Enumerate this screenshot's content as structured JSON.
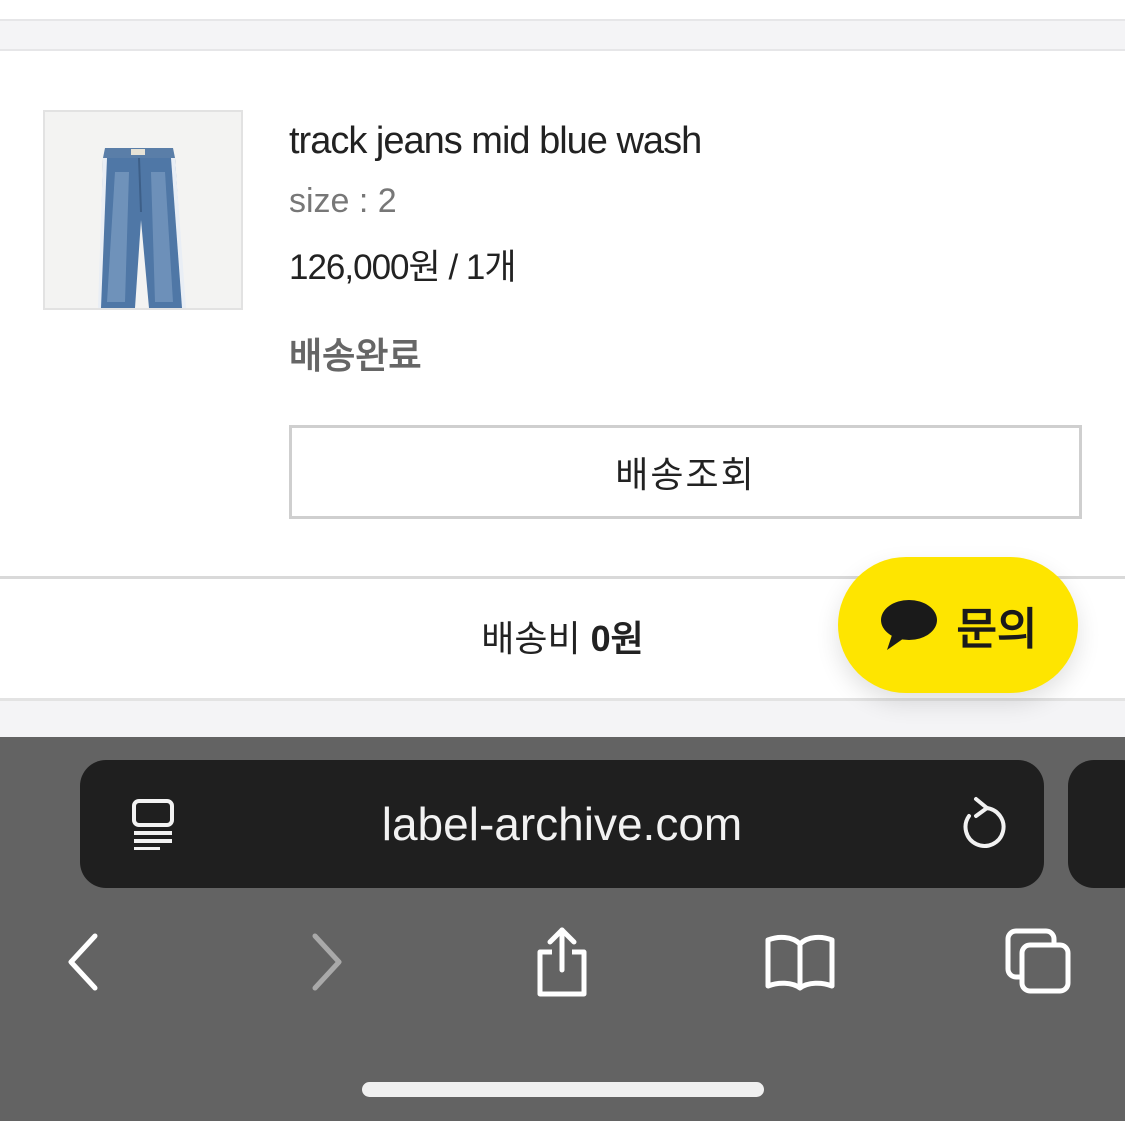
{
  "product": {
    "name": "track jeans mid blue wash",
    "size": "size : 2",
    "price": "126,000원 / 1개",
    "status": "배송완료",
    "track_button": "배송조회"
  },
  "shipping": {
    "label": "배송비",
    "value": "0원"
  },
  "chat": {
    "label": "문의",
    "icon": "speech-bubble-icon"
  },
  "browser": {
    "url": "label-archive.com",
    "icons": [
      "reader-mode-icon",
      "reload-icon",
      "back-icon",
      "forward-icon",
      "share-icon",
      "bookmarks-icon",
      "tabs-icon"
    ]
  },
  "colors": {
    "chat_bg": "#fee500",
    "browser_bg": "#636363",
    "url_pill_bg": "#1f1f1f"
  }
}
